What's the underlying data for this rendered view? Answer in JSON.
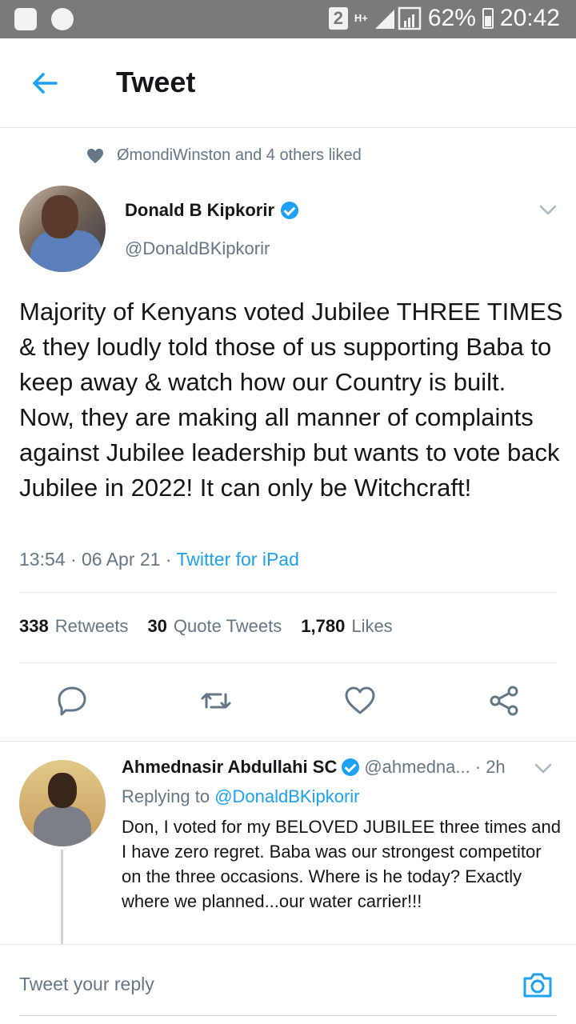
{
  "status_bar": {
    "sim": "2",
    "network": "H+",
    "battery": "62%",
    "time": "20:42"
  },
  "header": {
    "title": "Tweet"
  },
  "social_context": "ØmondiWinston and 4 others liked",
  "tweet": {
    "author_name": "Donald B Kipkorir",
    "author_handle": "@DonaldBKipkorir",
    "text": "Majority of Kenyans voted Jubilee THREE TIMES & they loudly told those of us supporting Baba to keep away & watch how our Country is built. Now, they are making all manner of complaints against Jubilee leadership but wants to vote back Jubilee in 2022! It can only be Witchcraft!",
    "timestamp": "13:54 · 06 Apr 21 · ",
    "source": "Twitter for iPad"
  },
  "stats": {
    "retweets_count": "338",
    "retweets_label": "Retweets",
    "quotes_count": "30",
    "quotes_label": "Quote Tweets",
    "likes_count": "1,780",
    "likes_label": "Likes"
  },
  "reply": {
    "name": "Ahmednasir Abdullahi SC",
    "handle": "@ahmedna...",
    "time": "· 2h",
    "replying_prefix": "Replying to ",
    "replying_to": "@DonaldBKipkorir",
    "text": "Don, I voted for my BELOVED JUBILEE three times and I have zero regret. Baba was our strongest competitor on the three occasions. Where is he today? Exactly where we planned...our water carrier!!!"
  },
  "composer": {
    "placeholder": "Tweet your reply"
  },
  "colors": {
    "accent": "#1da1f2",
    "secondary_text": "#657786",
    "status_bar": "#7a7a7a"
  },
  "icons": [
    "recycle-icon",
    "alert-icon",
    "signal-icon",
    "battery-icon",
    "back-arrow-icon",
    "heart-icon",
    "verified-icon",
    "chevron-down-icon",
    "reply-icon",
    "retweet-icon",
    "like-icon",
    "share-icon",
    "camera-icon"
  ]
}
